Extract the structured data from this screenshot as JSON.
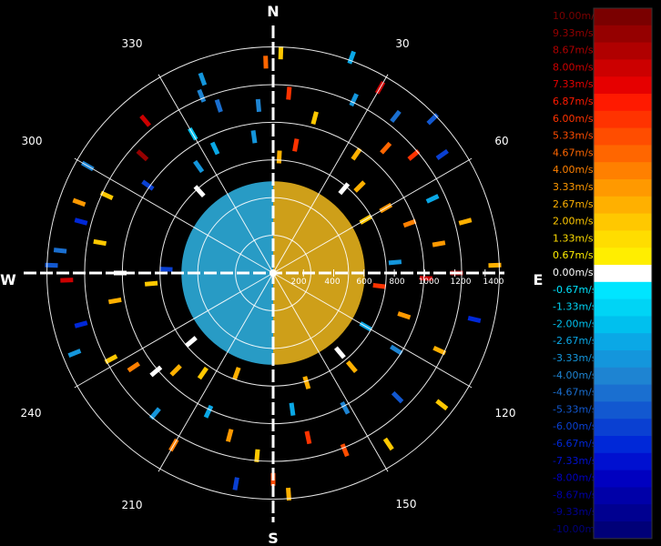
{
  "chart_data": {
    "type": "polar-radar-velocity",
    "cardinals": [
      "N",
      "E",
      "S",
      "W"
    ],
    "azimuth_ticks": [
      "30",
      "60",
      "120",
      "150",
      "210",
      "240",
      "300",
      "330"
    ],
    "range_ticks": [
      "200",
      "400",
      "600",
      "800",
      "1000",
      "1200",
      "1400"
    ],
    "range_max": 1500,
    "legend": {
      "labels": [
        "10.00m/s",
        "9.33m/s",
        "8.67m/s",
        "8.00m/s",
        "7.33m/s",
        "6.87m/s",
        "6.00m/s",
        "5.33m/s",
        "4.67m/s",
        "4.00m/s",
        "3.33m/s",
        "2.67m/s",
        "2.00m/s",
        "1.33m/s",
        "0.67m/s",
        "0.00m/s",
        "-0.67m/s",
        "-1.33m/s",
        "-2.00m/s",
        "-2.67m/s",
        "-3.33m/s",
        "-4.00m/s",
        "-4.67m/s",
        "-5.33m/s",
        "-6.00m/s",
        "-6.67m/s",
        "-7.33m/s",
        "-8.00m/s",
        "-8.67m/s",
        "-9.33m/s",
        "-10.00m/s"
      ],
      "colors": [
        "#7a0000",
        "#950000",
        "#b00000",
        "#cc0000",
        "#e60000",
        "#ff1a00",
        "#ff3300",
        "#ff4d00",
        "#ff6600",
        "#ff8000",
        "#ff9900",
        "#ffb000",
        "#ffc800",
        "#ffdd00",
        "#ffee00",
        "#ffffff",
        "#00e5ff",
        "#00d4f5",
        "#00c0ee",
        "#0aa8e6",
        "#1496dc",
        "#1e84d2",
        "#1a6fd0",
        "#1258d0",
        "#0a40d2",
        "#0028d8",
        "#0010d0",
        "#0000c0",
        "#0000a8",
        "#000090",
        "#000078"
      ]
    },
    "data_note_visible": "",
    "core": {
      "max_range": 600,
      "north_side_color": "#d9a81a",
      "south_side_color": "#2aa3d0"
    },
    "gates": [
      {
        "az": 2,
        "r": 1440,
        "v": 2.0
      },
      {
        "az": 358,
        "r": 1380,
        "v": 4.5
      },
      {
        "az": 5,
        "r": 1180,
        "v": 6.0
      },
      {
        "az": 355,
        "r": 1100,
        "v": -4.0
      },
      {
        "az": 352,
        "r": 900,
        "v": -3.3
      },
      {
        "az": 3,
        "r": 760,
        "v": 2.7
      },
      {
        "az": 340,
        "r": 1350,
        "v": -3.3
      },
      {
        "az": 338,
        "r": 1250,
        "v": -4.0
      },
      {
        "az": 342,
        "r": 1150,
        "v": -4.7
      },
      {
        "az": 335,
        "r": 900,
        "v": -2.7
      },
      {
        "az": 330,
        "r": 1050,
        "v": -2.0
      },
      {
        "az": 325,
        "r": 850,
        "v": -3.3
      },
      {
        "az": 320,
        "r": 1300,
        "v": 8.0
      },
      {
        "az": 312,
        "r": 1150,
        "v": 9.3
      },
      {
        "az": 305,
        "r": 1000,
        "v": -6.0
      },
      {
        "az": 300,
        "r": 1400,
        "v": -4.0
      },
      {
        "az": 295,
        "r": 1200,
        "v": 2.0
      },
      {
        "az": 290,
        "r": 1350,
        "v": 3.3
      },
      {
        "az": 285,
        "r": 1300,
        "v": -6.7
      },
      {
        "az": 280,
        "r": 1150,
        "v": 2.0
      },
      {
        "az": 276,
        "r": 1400,
        "v": -4.7
      },
      {
        "az": 272,
        "r": 1450,
        "v": -5.3
      },
      {
        "az": 268,
        "r": 1350,
        "v": 8.0
      },
      {
        "az": 270,
        "r": 1000,
        "v": 0.0
      },
      {
        "az": 272,
        "r": 700,
        "v": -6.0
      },
      {
        "az": 265,
        "r": 800,
        "v": 2.0
      },
      {
        "az": 260,
        "r": 1050,
        "v": 2.7
      },
      {
        "az": 255,
        "r": 1300,
        "v": -6.7
      },
      {
        "az": 248,
        "r": 1400,
        "v": -3.3
      },
      {
        "az": 242,
        "r": 1200,
        "v": 2.0
      },
      {
        "az": 236,
        "r": 1100,
        "v": 4.0
      },
      {
        "az": 230,
        "r": 1000,
        "v": 0.0
      },
      {
        "az": 225,
        "r": 900,
        "v": 2.7
      },
      {
        "az": 220,
        "r": 1200,
        "v": -3.3
      },
      {
        "az": 215,
        "r": 800,
        "v": 2.0
      },
      {
        "az": 210,
        "r": 1300,
        "v": 4.0
      },
      {
        "az": 205,
        "r": 1000,
        "v": -2.7
      },
      {
        "az": 200,
        "r": 700,
        "v": 2.7
      },
      {
        "az": 195,
        "r": 1100,
        "v": 3.3
      },
      {
        "az": 190,
        "r": 1400,
        "v": -6.0
      },
      {
        "az": 185,
        "r": 1200,
        "v": 2.0
      },
      {
        "az": 180,
        "r": 1350,
        "v": 5.3
      },
      {
        "az": 176,
        "r": 1450,
        "v": 2.7
      },
      {
        "az": 172,
        "r": 900,
        "v": -2.7
      },
      {
        "az": 168,
        "r": 1100,
        "v": 6.0
      },
      {
        "az": 163,
        "r": 750,
        "v": 2.7
      },
      {
        "az": 158,
        "r": 1250,
        "v": 5.3
      },
      {
        "az": 152,
        "r": 1000,
        "v": -4.0
      },
      {
        "az": 146,
        "r": 1350,
        "v": 2.0
      },
      {
        "az": 140,
        "r": 800,
        "v": 2.7
      },
      {
        "az": 135,
        "r": 1150,
        "v": -5.3
      },
      {
        "az": 128,
        "r": 1400,
        "v": 2.0
      },
      {
        "az": 122,
        "r": 950,
        "v": -4.0
      },
      {
        "az": 115,
        "r": 1200,
        "v": 2.7
      },
      {
        "az": 108,
        "r": 900,
        "v": 3.3
      },
      {
        "az": 103,
        "r": 1350,
        "v": -6.7
      },
      {
        "az": 97,
        "r": 700,
        "v": 6.0
      },
      {
        "az": 92,
        "r": 1000,
        "v": 8.0
      },
      {
        "az": 90,
        "r": 1200,
        "v": 8.7
      },
      {
        "az": 88,
        "r": 1450,
        "v": 2.7
      },
      {
        "az": 85,
        "r": 800,
        "v": -3.3
      },
      {
        "az": 80,
        "r": 1100,
        "v": 3.3
      },
      {
        "az": 75,
        "r": 1300,
        "v": 2.7
      },
      {
        "az": 70,
        "r": 950,
        "v": 4.0
      },
      {
        "az": 65,
        "r": 1150,
        "v": -2.7
      },
      {
        "az": 60,
        "r": 850,
        "v": 3.3
      },
      {
        "az": 55,
        "r": 1350,
        "v": -6.0
      },
      {
        "az": 50,
        "r": 1200,
        "v": 6.0
      },
      {
        "az": 46,
        "r": 1450,
        "v": -5.3
      },
      {
        "az": 42,
        "r": 1100,
        "v": 4.7
      },
      {
        "az": 38,
        "r": 1300,
        "v": -4.7
      },
      {
        "az": 35,
        "r": 950,
        "v": 2.7
      },
      {
        "az": 30,
        "r": 1400,
        "v": 8.0
      },
      {
        "az": 25,
        "r": 1250,
        "v": -3.3
      },
      {
        "az": 20,
        "r": 1500,
        "v": -2.7
      },
      {
        "az": 15,
        "r": 1050,
        "v": 2.0
      },
      {
        "az": 10,
        "r": 850,
        "v": 6.0
      },
      {
        "az": 45,
        "r": 800,
        "v": 2.7
      },
      {
        "az": 40,
        "r": 720,
        "v": 0.0
      },
      {
        "az": 318,
        "r": 720,
        "v": 0.0
      },
      {
        "az": 230,
        "r": 700,
        "v": 0.0
      },
      {
        "az": 140,
        "r": 680,
        "v": 0.0
      },
      {
        "az": 120,
        "r": 700,
        "v": -2.7
      },
      {
        "az": 60,
        "r": 700,
        "v": 2.0
      }
    ]
  }
}
